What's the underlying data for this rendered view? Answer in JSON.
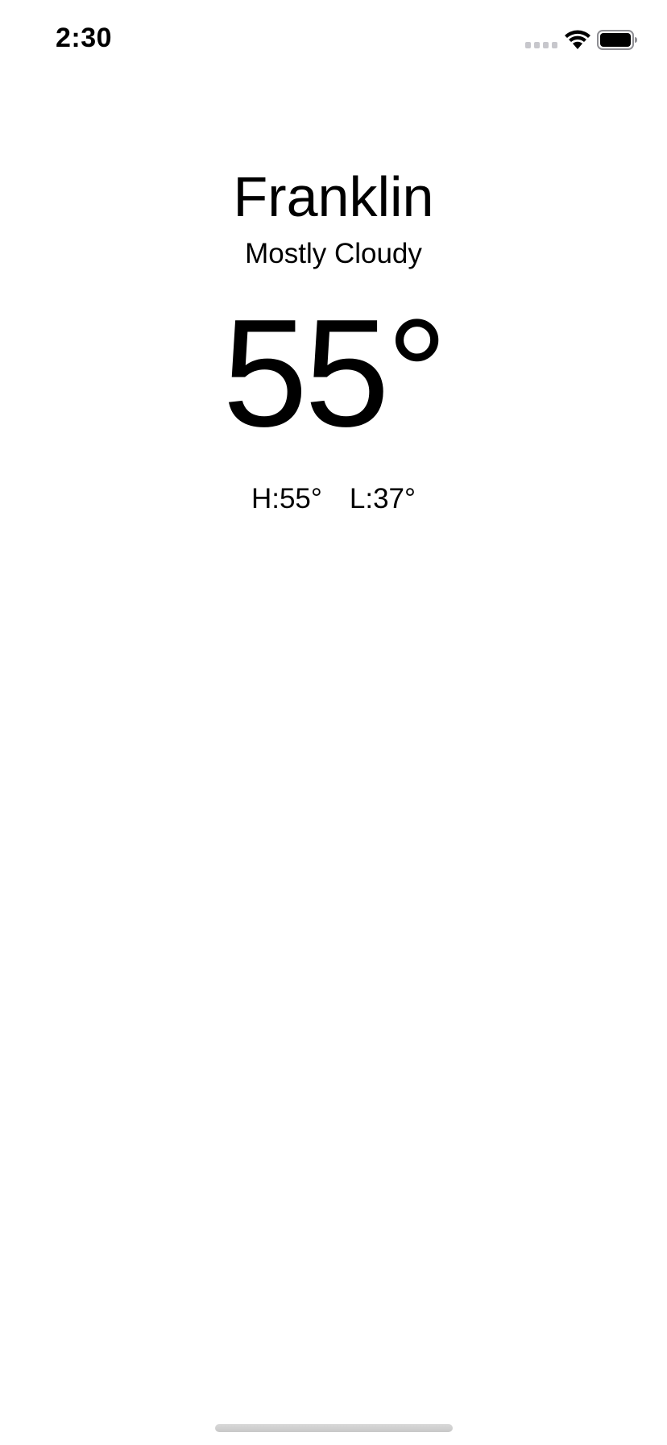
{
  "status_bar": {
    "time": "2:30",
    "signal_icon": "cellular-signal-icon",
    "wifi_icon": "wifi-icon",
    "battery_icon": "battery-icon"
  },
  "weather": {
    "city": "Franklin",
    "condition": "Mostly Cloudy",
    "temperature": "55°",
    "high": "H:55°",
    "low": "L:37°"
  },
  "colors": {
    "background": "#ffffff",
    "text": "#000000",
    "inactive_signal": "#c7c7cc"
  }
}
